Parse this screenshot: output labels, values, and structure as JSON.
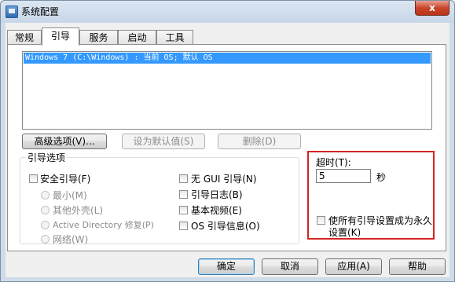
{
  "window": {
    "title": "系统配置",
    "close_glyph": "x"
  },
  "tabs": [
    {
      "label": "常规"
    },
    {
      "label": "引导"
    },
    {
      "label": "服务"
    },
    {
      "label": "启动"
    },
    {
      "label": "工具"
    }
  ],
  "active_tab": "引导",
  "os_list": {
    "items": [
      "Windows 7 (C:\\Windows) : 当前 OS; 默认 OS"
    ]
  },
  "actions": {
    "advanced": "高级选项(V)...",
    "set_default": "设为默认值(S)",
    "delete": "删除(D)"
  },
  "boot_options": {
    "group_label": "引导选项",
    "safe_boot": "安全引导(F)",
    "radios": [
      "最小(M)",
      "其他外壳(L)",
      "Active Directory 修复(P)",
      "网络(W)"
    ],
    "no_gui": "无 GUI 引导(N)",
    "boot_log": "引导日志(B)",
    "base_video": "基本视频(E)",
    "os_info": "OS 引导信息(O)"
  },
  "timeout": {
    "label": "超时(T):",
    "value": "5",
    "unit": "秒",
    "permanent_line1": "使所有引导设置成为永久",
    "permanent_line2": "设置(K)"
  },
  "buttons": {
    "ok": "确定",
    "cancel": "取消",
    "apply": "应用(A)",
    "help": "帮助"
  }
}
